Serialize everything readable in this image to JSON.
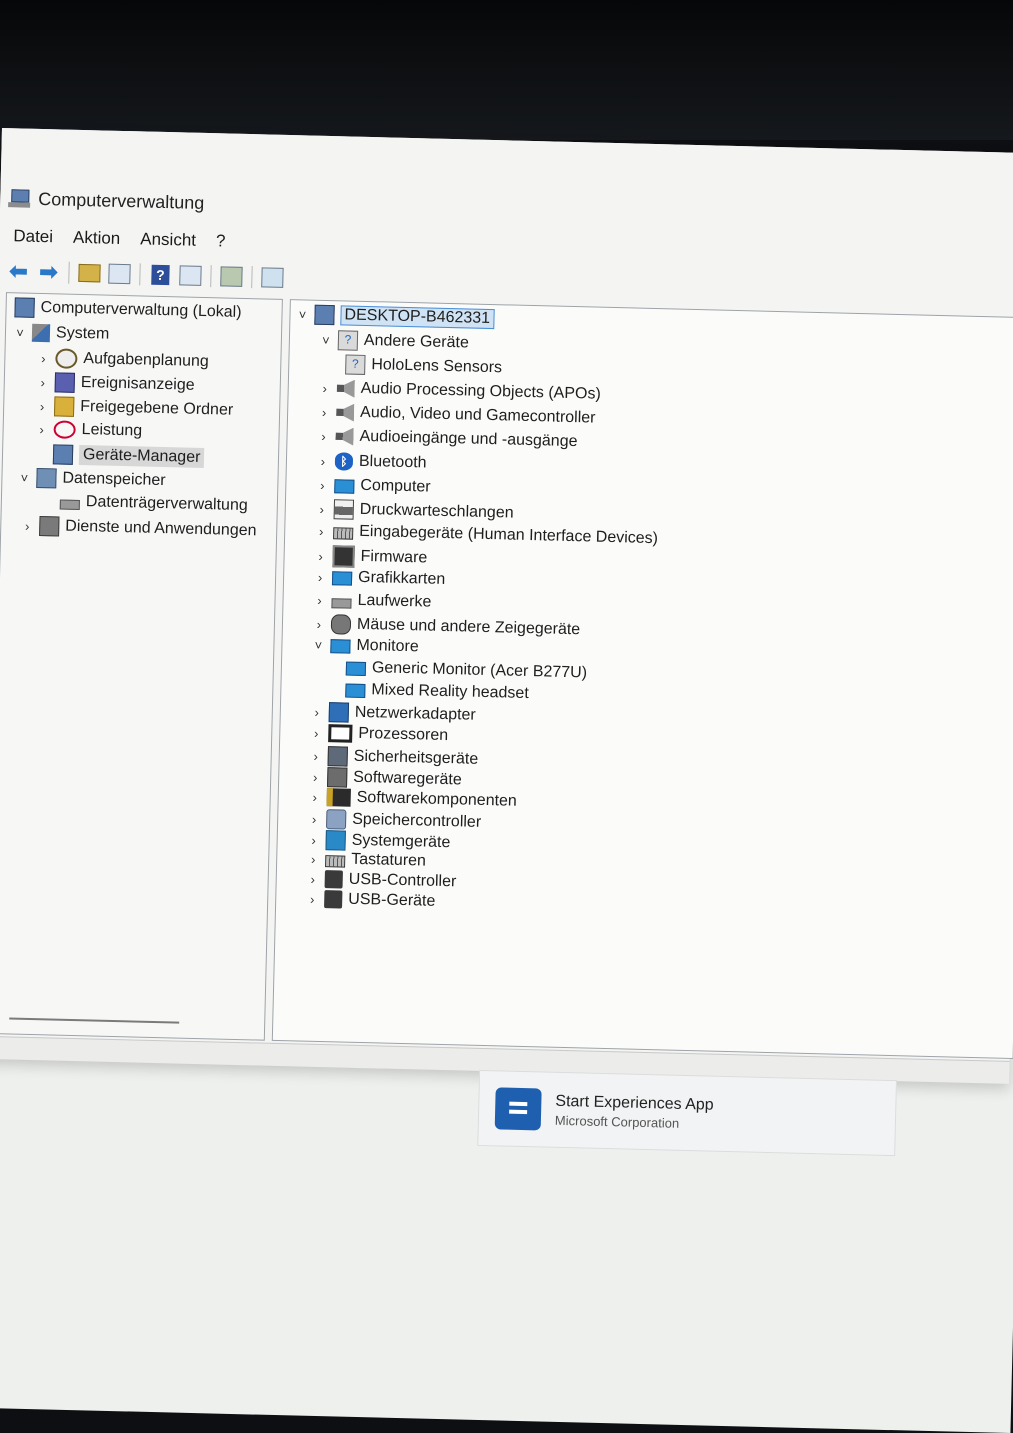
{
  "window": {
    "title": "Computerverwaltung"
  },
  "menu": [
    "Datei",
    "Aktion",
    "Ansicht",
    "?"
  ],
  "left_tree": {
    "root": "Computerverwaltung (Lokal)",
    "system": "System",
    "aufgabenplanung": "Aufgabenplanung",
    "ereignisanzeige": "Ereignisanzeige",
    "freigegebene_ordner": "Freigegebene Ordner",
    "leistung": "Leistung",
    "geraete_manager": "Geräte-Manager",
    "datenspeicher": "Datenspeicher",
    "datentraeger": "Datenträgerverwaltung",
    "dienste": "Dienste und Anwendungen"
  },
  "device_tree": {
    "computer_name": "DESKTOP-B462331",
    "items": [
      "Andere Geräte",
      "HoloLens Sensors",
      "Audio Processing Objects (APOs)",
      "Audio, Video und Gamecontroller",
      "Audioeingänge und -ausgänge",
      "Bluetooth",
      "Computer",
      "Druckwarteschlangen",
      "Eingabegeräte (Human Interface Devices)",
      "Firmware",
      "Grafikkarten",
      "Laufwerke",
      "Mäuse und andere Zeigegeräte",
      "Monitore",
      "Generic Monitor (Acer B277U)",
      "Mixed Reality headset",
      "Netzwerkadapter",
      "Prozessoren",
      "Sicherheitsgeräte",
      "Softwaregeräte",
      "Softwarekomponenten",
      "Speichercontroller",
      "Systemgeräte",
      "Tastaturen",
      "USB-Controller",
      "USB-Geräte"
    ]
  },
  "notification": {
    "app": "Start Experiences App",
    "publisher": "Microsoft Corporation"
  }
}
